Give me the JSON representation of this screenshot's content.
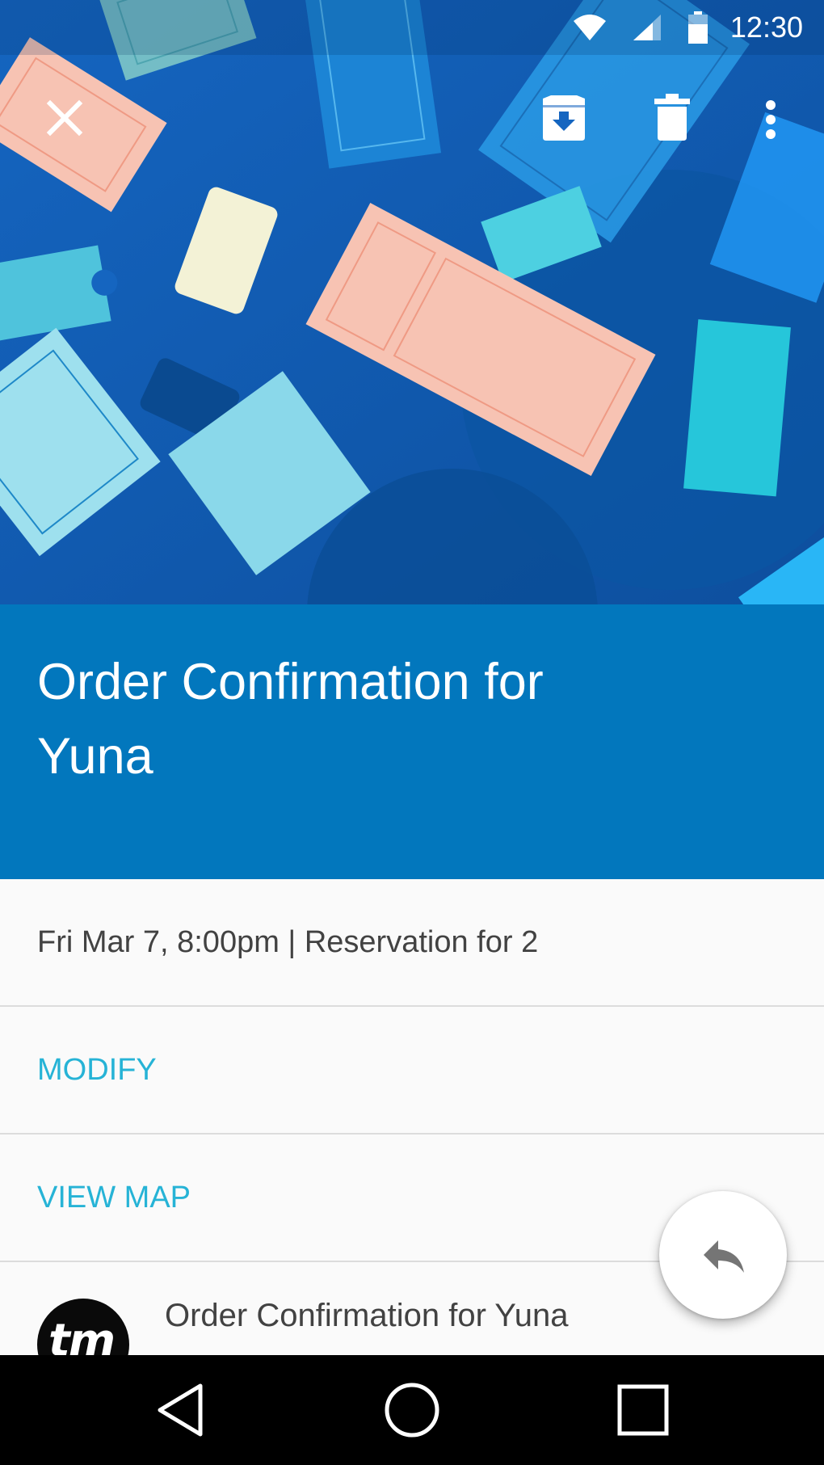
{
  "status_bar": {
    "time": "12:30",
    "icons": [
      "wifi-icon",
      "cellular-signal-icon",
      "battery-icon"
    ]
  },
  "toolbar": {
    "icons": [
      "close-icon",
      "archive-icon",
      "delete-icon",
      "more-vert-icon"
    ]
  },
  "message": {
    "title": "Order Confirmation for Yuna",
    "details": "Fri Mar 7, 8:00pm | Reservation for 2",
    "actions": [
      "MODIFY",
      "VIEW MAP"
    ]
  },
  "sender": {
    "avatar_text": "tm",
    "subject": "Order Confirmation for Yuna"
  },
  "fab": {
    "icon": "reply-icon"
  },
  "nav_bar": {
    "icons": [
      "back-icon",
      "home-icon",
      "recents-icon"
    ]
  },
  "colors": {
    "hero_background": "#0f63b4",
    "title_background": "#0277bd",
    "action_text": "#26b3d6",
    "body_text": "#424242",
    "ticket_pink": "#f7c3b3",
    "ticket_light_blue": "#8ad8ea",
    "ticket_cream": "#f3f2d6"
  }
}
